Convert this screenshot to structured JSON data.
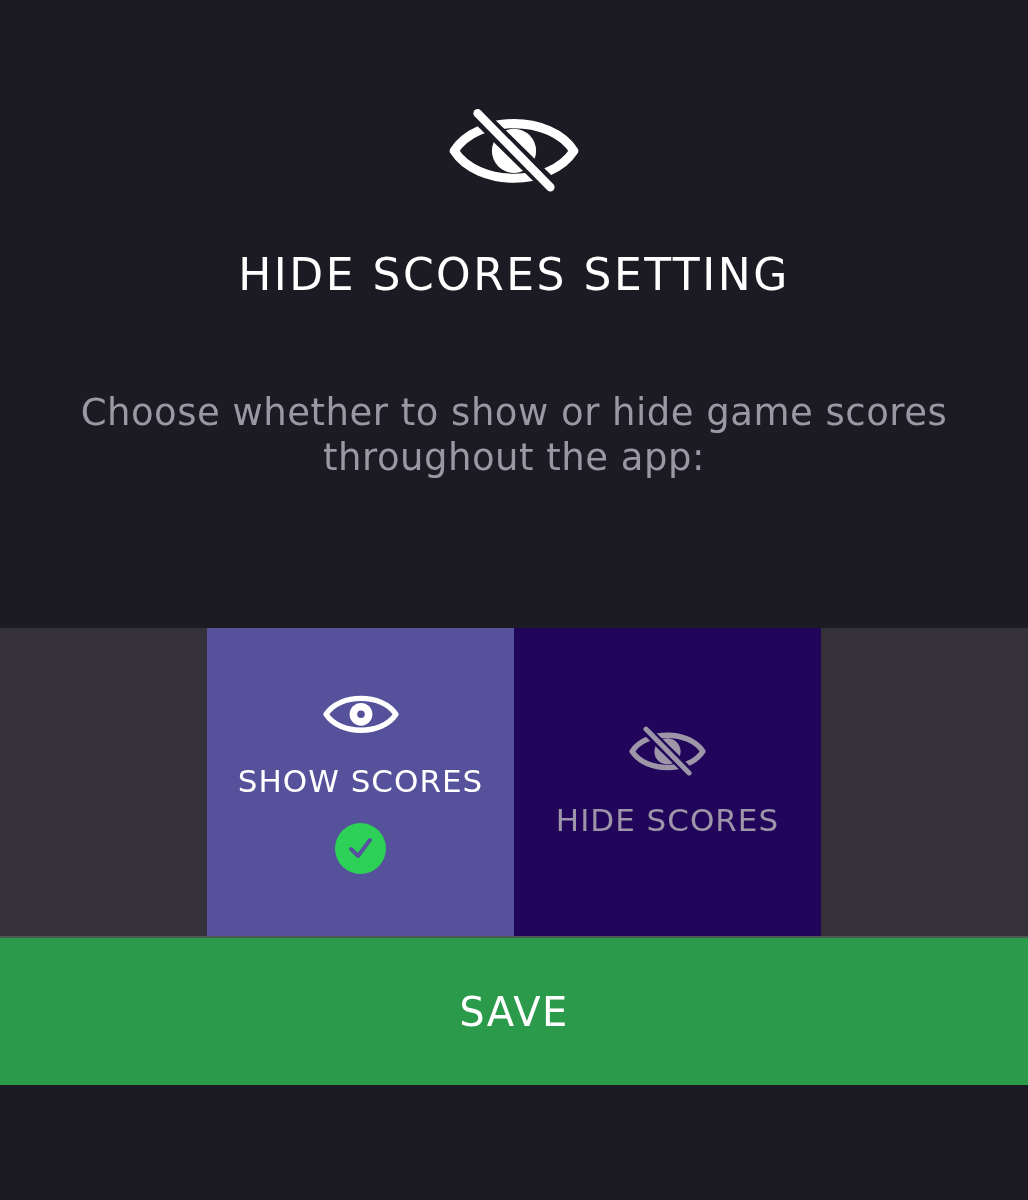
{
  "header": {
    "title": "HIDE SCORES SETTING",
    "description": "Choose whether to show or hide game scores throughout the app:"
  },
  "options": [
    {
      "kind": "show",
      "label": "SHOW SCORES",
      "selected": true
    },
    {
      "kind": "hide",
      "label": "HIDE SCORES",
      "selected": false
    }
  ],
  "save_button": {
    "label": "SAVE"
  }
}
